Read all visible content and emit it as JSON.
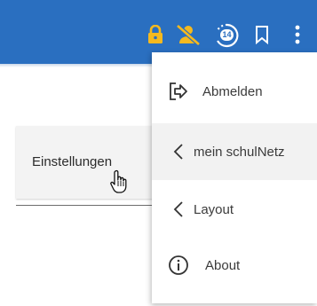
{
  "topbar": {
    "background": "#2a6fc0",
    "icons": [
      "lock-icon",
      "person-off-icon",
      "timer-icon",
      "bookmark-icon",
      "more-vert-icon"
    ],
    "timer_badge": "14",
    "icon_color": "#f5b91f"
  },
  "background_card": {
    "label": "Einstellungen"
  },
  "menu": {
    "items": [
      {
        "label": "Abmelden",
        "icon": "logout-icon"
      },
      {
        "label": "mein schulNetz",
        "icon": "chevron-left-icon"
      },
      {
        "label": "Layout",
        "icon": "chevron-left-icon"
      },
      {
        "label": "About",
        "icon": "info-icon"
      }
    ]
  }
}
